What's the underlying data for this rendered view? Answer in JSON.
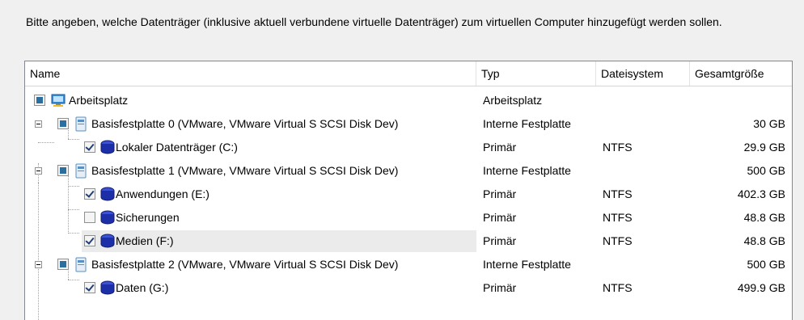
{
  "instruction": "Bitte angeben, welche Datenträger (inklusive aktuell verbundene virtuelle Datenträger) zum virtuellen Computer hinzugefügt werden sollen.",
  "columns": [
    "Name",
    "Typ",
    "Dateisystem",
    "Gesamtgröße"
  ],
  "rows": [
    {
      "name": "Arbeitsplatz",
      "type": "Arbeitsplatz",
      "fs": "",
      "size": "",
      "check": "partial",
      "icon": "computer-icon"
    },
    {
      "name": "Basisfestplatte 0 (VMware, VMware Virtual S SCSI Disk Dev)",
      "type": "Interne Festplatte",
      "fs": "",
      "size": "30 GB",
      "check": "partial",
      "icon": "hard-disk-icon"
    },
    {
      "name": "Lokaler Datenträger (C:)",
      "type": "Primär",
      "fs": "NTFS",
      "size": "29.9 GB",
      "check": "checked",
      "icon": "volume-icon"
    },
    {
      "name": "Basisfestplatte 1 (VMware, VMware Virtual S SCSI Disk Dev)",
      "type": "Interne Festplatte",
      "fs": "",
      "size": "500 GB",
      "check": "partial",
      "icon": "hard-disk-icon"
    },
    {
      "name": "Anwendungen (E:)",
      "type": "Primär",
      "fs": "NTFS",
      "size": "402.3 GB",
      "check": "checked",
      "icon": "volume-icon"
    },
    {
      "name": "Sicherungen",
      "type": "Primär",
      "fs": "NTFS",
      "size": "48.8 GB",
      "check": "unchecked",
      "icon": "volume-icon"
    },
    {
      "name": "Medien (F:)",
      "type": "Primär",
      "fs": "NTFS",
      "size": "48.8 GB",
      "check": "checked",
      "icon": "volume-icon"
    },
    {
      "name": "Basisfestplatte 2 (VMware, VMware Virtual S SCSI Disk Dev)",
      "type": "Interne Festplatte",
      "fs": "",
      "size": "500 GB",
      "check": "partial",
      "icon": "hard-disk-icon"
    },
    {
      "name": "Daten (G:)",
      "type": "Primär",
      "fs": "NTFS",
      "size": "499.9 GB",
      "check": "checked",
      "icon": "volume-icon"
    }
  ],
  "colors": {
    "accent": "#2b6f9e",
    "volume": "#1c2fa8",
    "highlight": "#ebebeb"
  }
}
